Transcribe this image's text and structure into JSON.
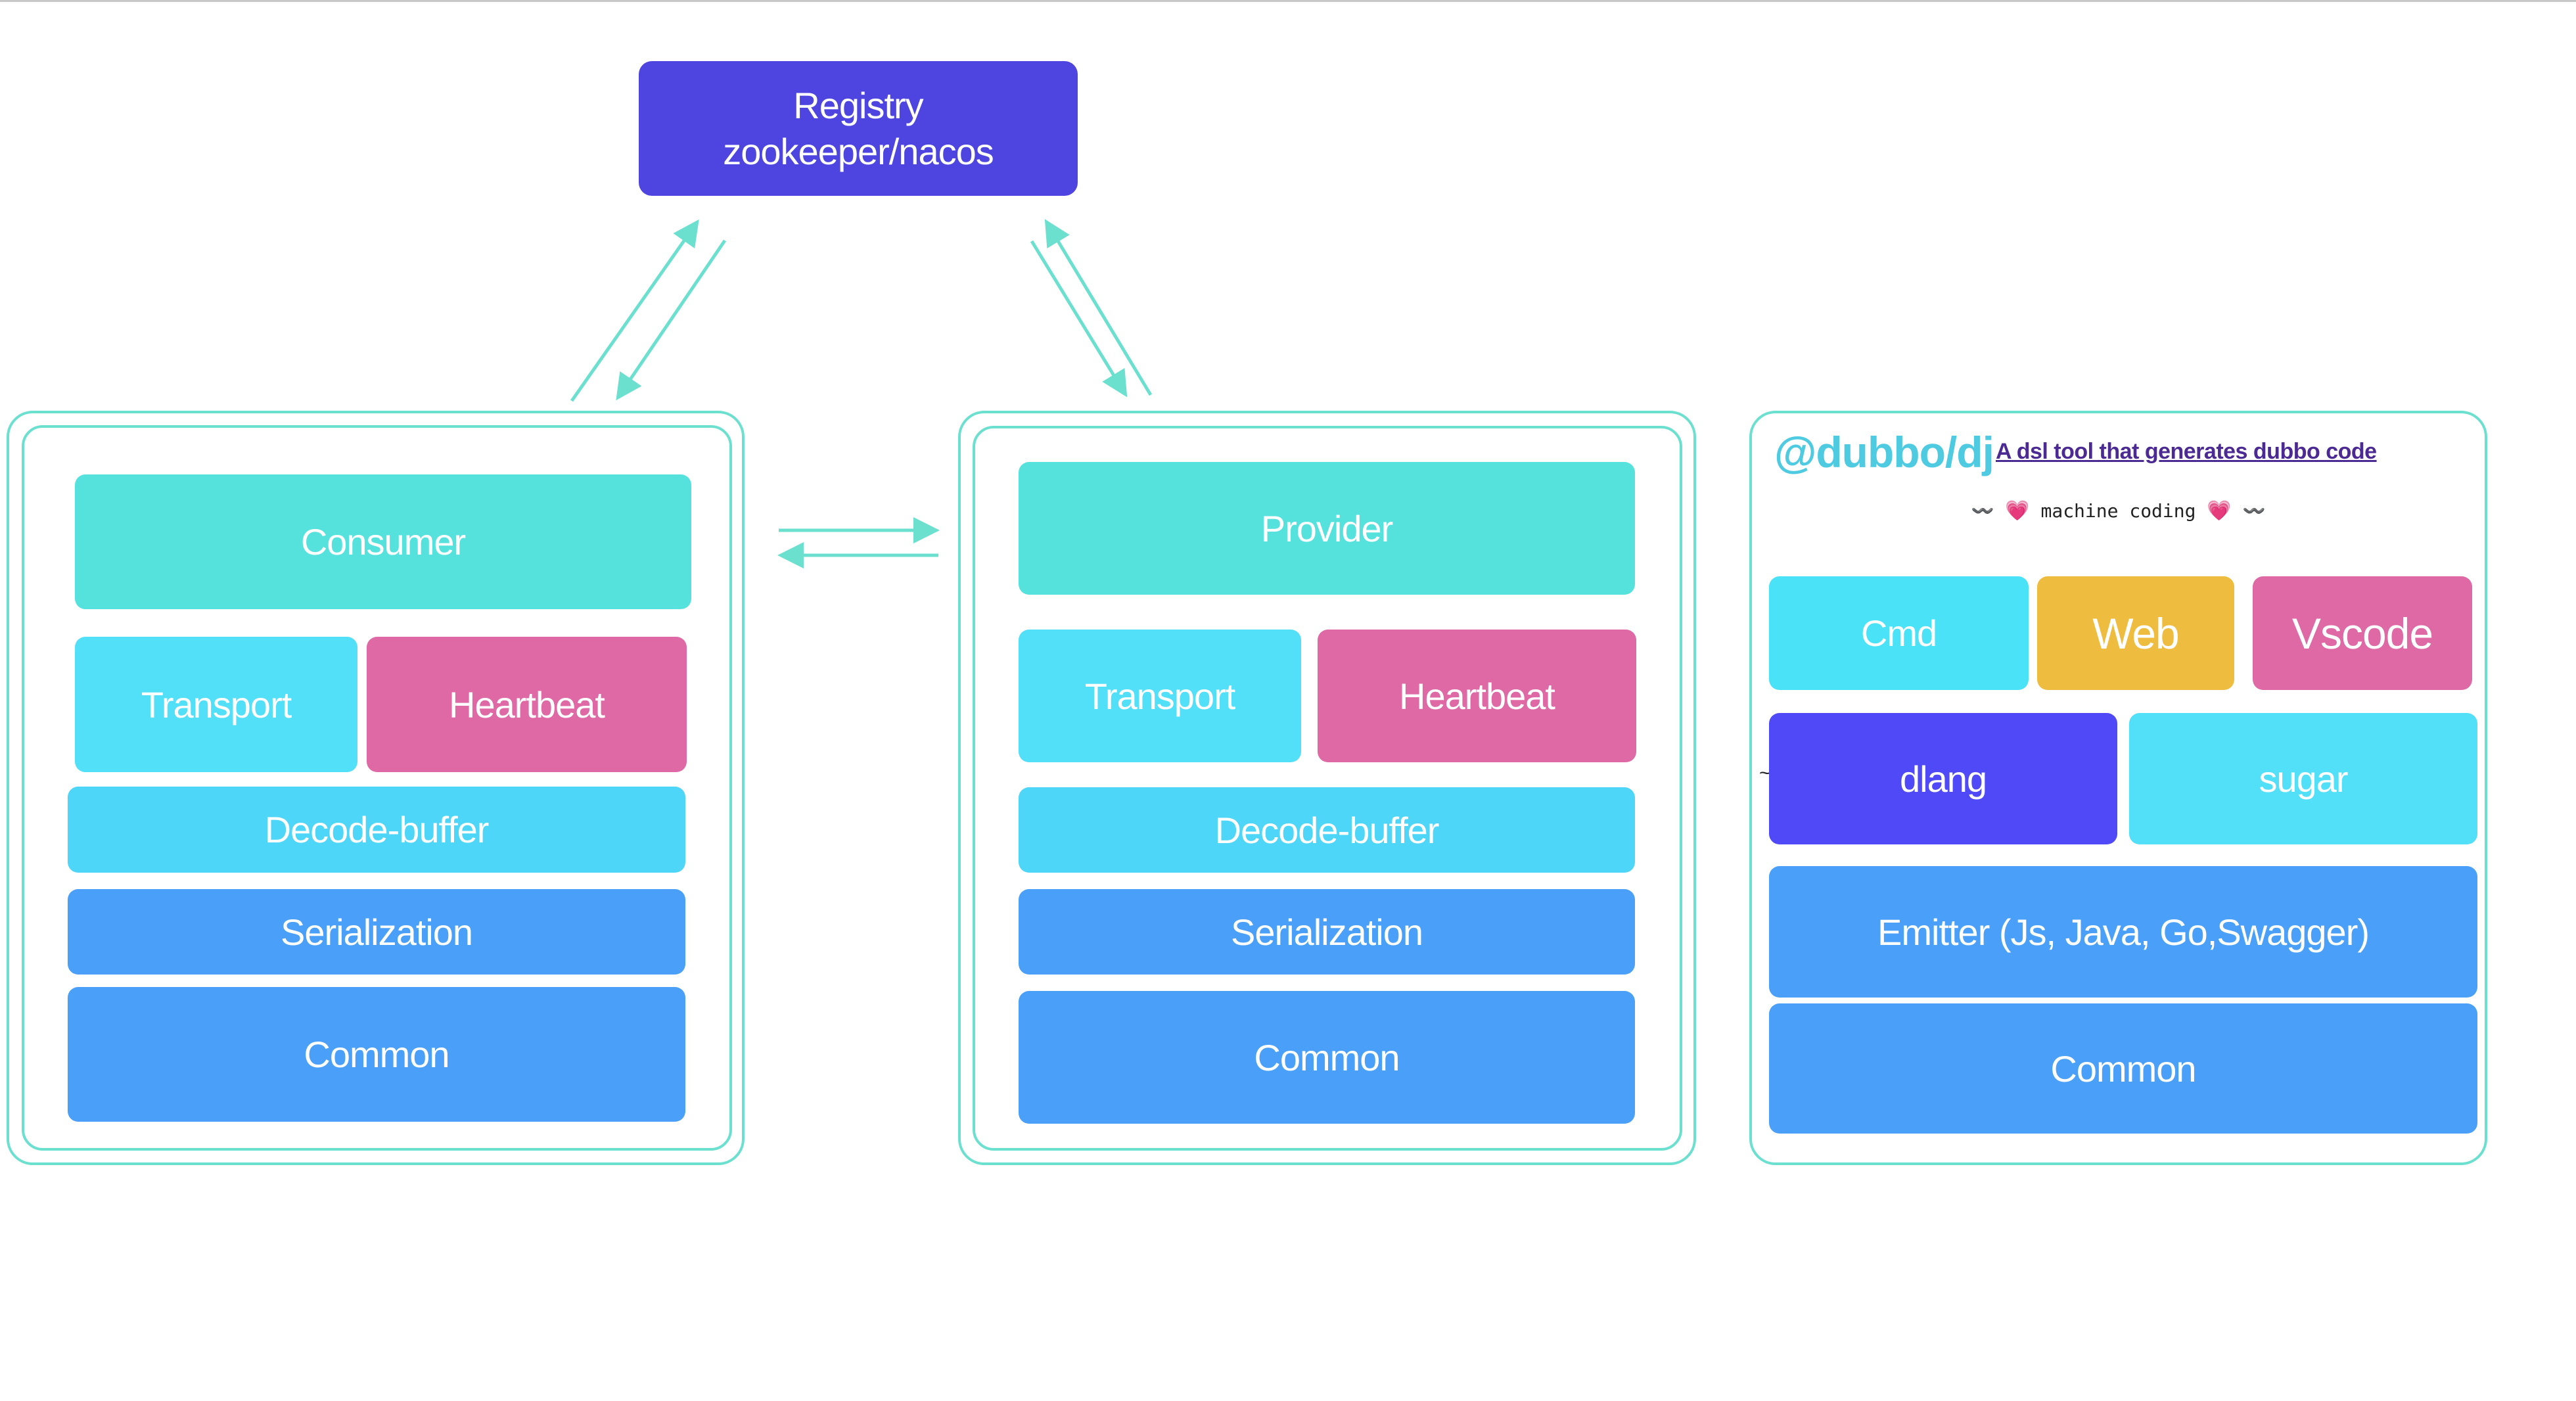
{
  "registry": {
    "line1": "Registry",
    "line2": "zookeeper/nacos"
  },
  "consumer_panel": {
    "role": "Consumer",
    "transport": "Transport",
    "heartbeat": "Heartbeat",
    "decode": "Decode-buffer",
    "serialization": "Serialization",
    "common": "Common"
  },
  "provider_panel": {
    "role": "Provider",
    "transport": "Transport",
    "heartbeat": "Heartbeat",
    "decode": "Decode-buffer",
    "serialization": "Serialization",
    "common": "Common"
  },
  "dj_panel": {
    "title": "@dubbo/dj",
    "link_text": "A dsl tool that generates dubbo code",
    "motto": {
      "left_wave": "〰️",
      "heart": "💗",
      "text": "machine coding",
      "right_wave": "〰️"
    },
    "tilde": "~",
    "targets": [
      "Cmd",
      "Web",
      "Vscode"
    ],
    "lang": [
      "dlang",
      "sugar"
    ],
    "emitter": "Emitter (Js, Java, Go,Swagger)",
    "common": "Common"
  },
  "colors": {
    "frame": "#6be0cf",
    "registry": "#4e45e1",
    "role": "#56e2dc",
    "transport": "#52dff8",
    "heartbeat": "#de69a4",
    "layer": "#4aa0f8",
    "web": "#eebd3f",
    "dlang": "#4f49f8",
    "dj_title": "#4ecbe0",
    "dj_link": "#4b2a93"
  }
}
